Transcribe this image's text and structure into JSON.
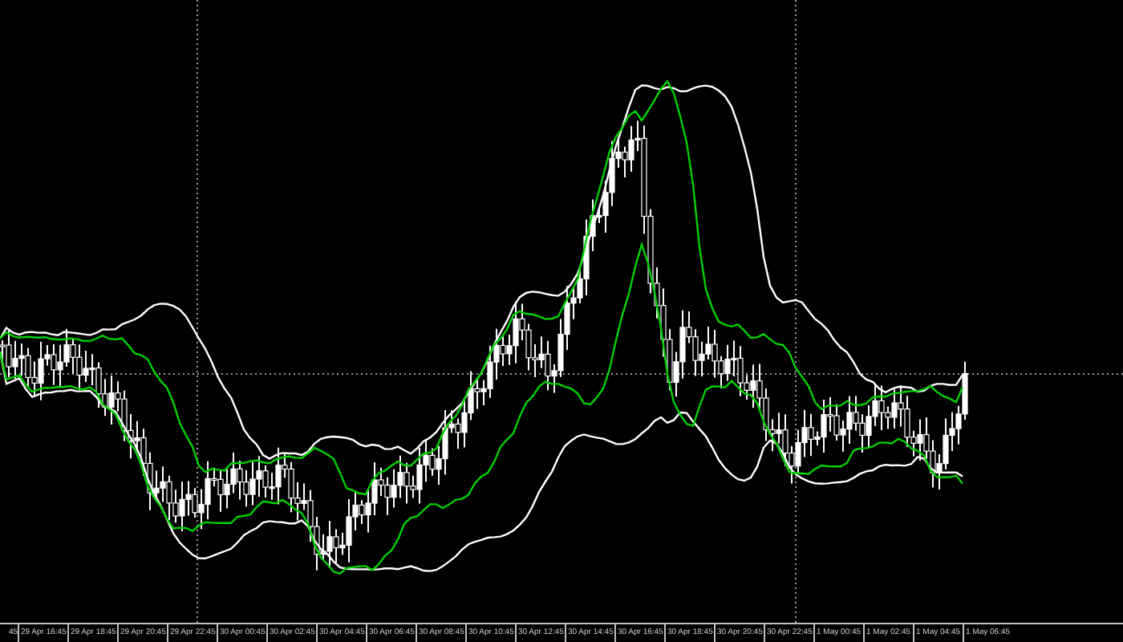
{
  "time_axis": {
    "labels": [
      "45",
      "29 Apr 16:45",
      "29 Apr 18:45",
      "29 Apr 20:45",
      "29 Apr 22:45",
      "30 Apr 00:45",
      "30 Apr 02:45",
      "30 Apr 04:45",
      "30 Apr 06:45",
      "30 Apr 08:45",
      "30 Apr 10:45",
      "30 Apr 12:45",
      "30 Apr 14:45",
      "30 Apr 16:45",
      "30 Apr 18:45",
      "30 Apr 20:45",
      "30 Apr 22:45",
      "1 May 00:45",
      "1 May 02:45",
      "1 May 04:45",
      "1 May 06:45"
    ]
  }
}
